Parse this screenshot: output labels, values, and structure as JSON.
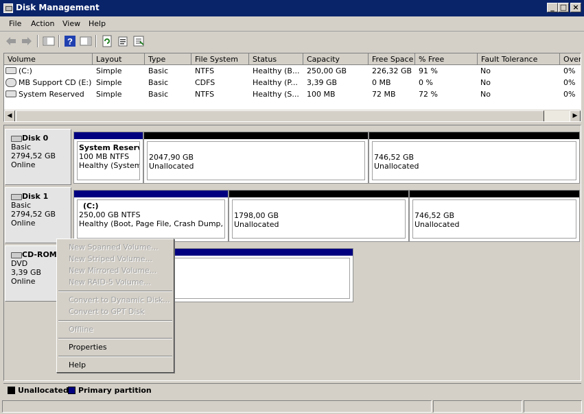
{
  "window": {
    "title": "Disk Management"
  },
  "menu": [
    "File",
    "Action",
    "View",
    "Help"
  ],
  "toolbar": {
    "icons": [
      "back-icon",
      "forward-icon",
      "show-hide-console-tree-icon",
      "help-icon",
      "show-hide-action-pane-icon",
      "refresh-icon",
      "properties-icon",
      "export-list-icon"
    ]
  },
  "volume_list": {
    "columns": [
      "Volume",
      "Layout",
      "Type",
      "File System",
      "Status",
      "Capacity",
      "Free Space",
      "% Free",
      "Fault Tolerance",
      "Overh"
    ],
    "rows": [
      {
        "volume": "(C:)",
        "layout": "Simple",
        "type": "Basic",
        "fs": "NTFS",
        "status": "Healthy (B...",
        "capacity": "250,00 GB",
        "free": "226,32 GB",
        "pct": "91 %",
        "fault": "No",
        "over": "0%"
      },
      {
        "volume": "MB Support CD (E:)",
        "layout": "Simple",
        "type": "Basic",
        "fs": "CDFS",
        "status": "Healthy (P...",
        "capacity": "3,39 GB",
        "free": "0 MB",
        "pct": "0 %",
        "fault": "No",
        "over": "0%"
      },
      {
        "volume": "System Reserved",
        "layout": "Simple",
        "type": "Basic",
        "fs": "NTFS",
        "status": "Healthy (S...",
        "capacity": "100 MB",
        "free": "72 MB",
        "pct": "72 %",
        "fault": "No",
        "over": "0%"
      }
    ]
  },
  "disks": [
    {
      "name": "Disk 0",
      "type": "Basic",
      "size": "2794,52 GB",
      "status": "Online",
      "partitions": [
        {
          "title": "System Reserve",
          "line1": "100 MB NTFS",
          "line2": "Healthy (System, A"
        },
        {
          "line1": "2047,90 GB",
          "line2": "Unallocated"
        },
        {
          "line1": "746,52 GB",
          "line2": "Unallocated"
        }
      ]
    },
    {
      "name": "Disk 1",
      "type": "Basic",
      "size": "2794,52 GB",
      "status": "Online",
      "partitions": [
        {
          "title": "(C:)",
          "line1": "250,00 GB NTFS",
          "line2": "Healthy (Boot, Page File, Crash Dump, Prima"
        },
        {
          "line1": "1798,00 GB",
          "line2": "Unallocated"
        },
        {
          "line1": "746,52 GB",
          "line2": "Unallocated"
        }
      ]
    },
    {
      "name": "CD-ROM",
      "type": "DVD",
      "size": "3,39 GB",
      "status": "Online"
    }
  ],
  "context_menu": {
    "items": [
      {
        "label": "New Spanned Volume...",
        "enabled": false
      },
      {
        "label": "New Striped Volume...",
        "enabled": false
      },
      {
        "label": "New Mirrored Volume...",
        "enabled": false
      },
      {
        "label": "New RAID-5 Volume...",
        "enabled": false
      },
      {
        "label": "Convert to Dynamic Disk...",
        "enabled": false
      },
      {
        "label": "Convert to GPT Disk",
        "enabled": false
      },
      {
        "label": "Offline",
        "enabled": false
      },
      {
        "label": "Properties",
        "enabled": true
      },
      {
        "label": "Help",
        "enabled": true
      }
    ]
  },
  "legend": [
    {
      "label": "Unallocated",
      "color": "#000000"
    },
    {
      "label": "Primary partition",
      "color": "#000080"
    }
  ],
  "colors": {
    "titlebar": "#0a246a",
    "primary": "#000080",
    "unallocated": "#000000"
  }
}
